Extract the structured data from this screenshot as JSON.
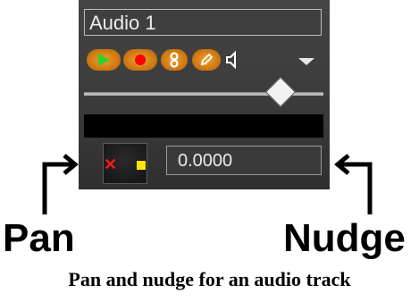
{
  "track": {
    "name": "Audio 1",
    "nudge_value": "0.0000"
  },
  "controls": {
    "buttons": [
      {
        "icon": "play-icon",
        "color": "#2bd42b"
      },
      {
        "icon": "record-icon",
        "color": "#ff0000"
      },
      {
        "icon": "solo-icon",
        "color": "#ffffff"
      },
      {
        "icon": "edit-icon",
        "color": "#ffffff"
      },
      {
        "icon": "speaker-icon",
        "color": "#ffffff"
      },
      {
        "icon": "chevron-down-icon",
        "color": "#ffffff"
      }
    ]
  },
  "labels": {
    "pan": "Pan",
    "nudge": "Nudge"
  },
  "caption": "Pan and nudge for an audio track",
  "colors": {
    "panel_bg": "#3a3a3a",
    "button_orange": "#e08a20",
    "pan_marker_x": "#ff1a1a",
    "pan_marker_square": "#ffe600"
  }
}
